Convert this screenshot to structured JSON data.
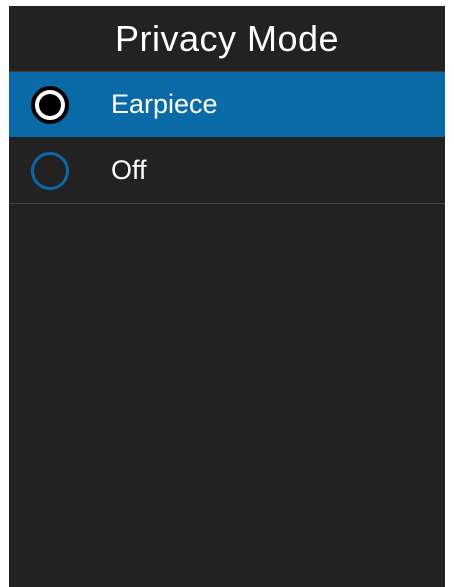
{
  "header": {
    "title": "Privacy Mode"
  },
  "options": [
    {
      "label": "Earpiece",
      "selected": true
    },
    {
      "label": "Off",
      "selected": false
    }
  ],
  "colors": {
    "background": "#222222",
    "accent": "#0a6aa8",
    "text": "#ffffff"
  },
  "icons": {
    "selected": "radio-checked-icon",
    "unselected": "radio-unchecked-icon"
  }
}
